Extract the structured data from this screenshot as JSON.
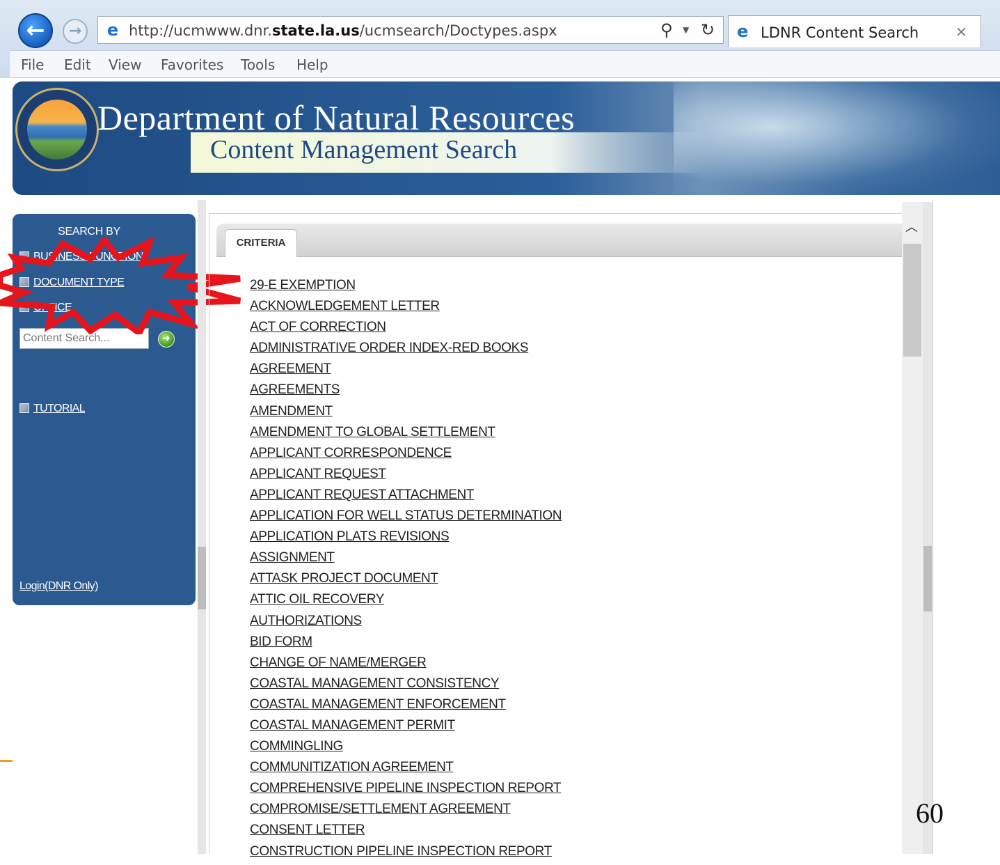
{
  "browser": {
    "url_prefix": "http://ucmwww.dnr.",
    "url_domain": "state.la.us",
    "url_suffix": "/ucmsearch/Doctypes.aspx",
    "tab_title": "LDNR Content Search",
    "menu": [
      "File",
      "Edit",
      "View",
      "Favorites",
      "Tools",
      "Help"
    ]
  },
  "banner": {
    "title": "Department of Natural Resources",
    "subtitle": "Content Management Search"
  },
  "sidebar": {
    "heading": "SEARCH BY",
    "links": [
      "BUSINESS FUNCTION",
      "DOCUMENT TYPE",
      "OFFICE"
    ],
    "search_placeholder": "Content Search...",
    "tutorial": "TUTORIAL",
    "login": "Login(DNR Only)"
  },
  "criteria": {
    "tab_label": "CRITERIA",
    "document_types": [
      "29-E EXEMPTION",
      "ACKNOWLEDGEMENT LETTER",
      "ACT OF CORRECTION",
      "ADMINISTRATIVE ORDER INDEX-RED BOOKS",
      "AGREEMENT",
      "AGREEMENTS",
      "AMENDMENT",
      "AMENDMENT TO GLOBAL SETTLEMENT",
      "APPLICANT CORRESPONDENCE",
      "APPLICANT REQUEST",
      "APPLICANT REQUEST ATTACHMENT",
      "APPLICATION FOR WELL STATUS DETERMINATION",
      "APPLICATION PLATS REVISIONS",
      "ASSIGNMENT",
      "ATTASK PROJECT DOCUMENT",
      "ATTIC OIL RECOVERY",
      "AUTHORIZATIONS",
      "BID FORM",
      "CHANGE OF NAME/MERGER",
      "COASTAL MANAGEMENT CONSISTENCY",
      "COASTAL MANAGEMENT ENFORCEMENT",
      "COASTAL MANAGEMENT PERMIT",
      "COMMINGLING",
      "COMMUNITIZATION AGREEMENT",
      "COMPREHENSIVE PIPELINE INSPECTION REPORT",
      "COMPROMISE/SETTLEMENT AGREEMENT",
      "CONSENT LETTER",
      "CONSTRUCTION PIPELINE INSPECTION REPORT"
    ]
  },
  "slide_number": "60",
  "colors": {
    "banner_blue": "#2b5f99",
    "panel_blue": "#2b5a91",
    "callout_red": "#e8141c"
  },
  "icons": {
    "back": "back-arrow-icon",
    "forward": "forward-arrow-icon",
    "ie": "ie-logo-icon",
    "search": "search-icon",
    "refresh": "refresh-icon",
    "close": "close-icon",
    "go": "go-arrow-icon",
    "scroll_up": "chevron-up-icon"
  }
}
